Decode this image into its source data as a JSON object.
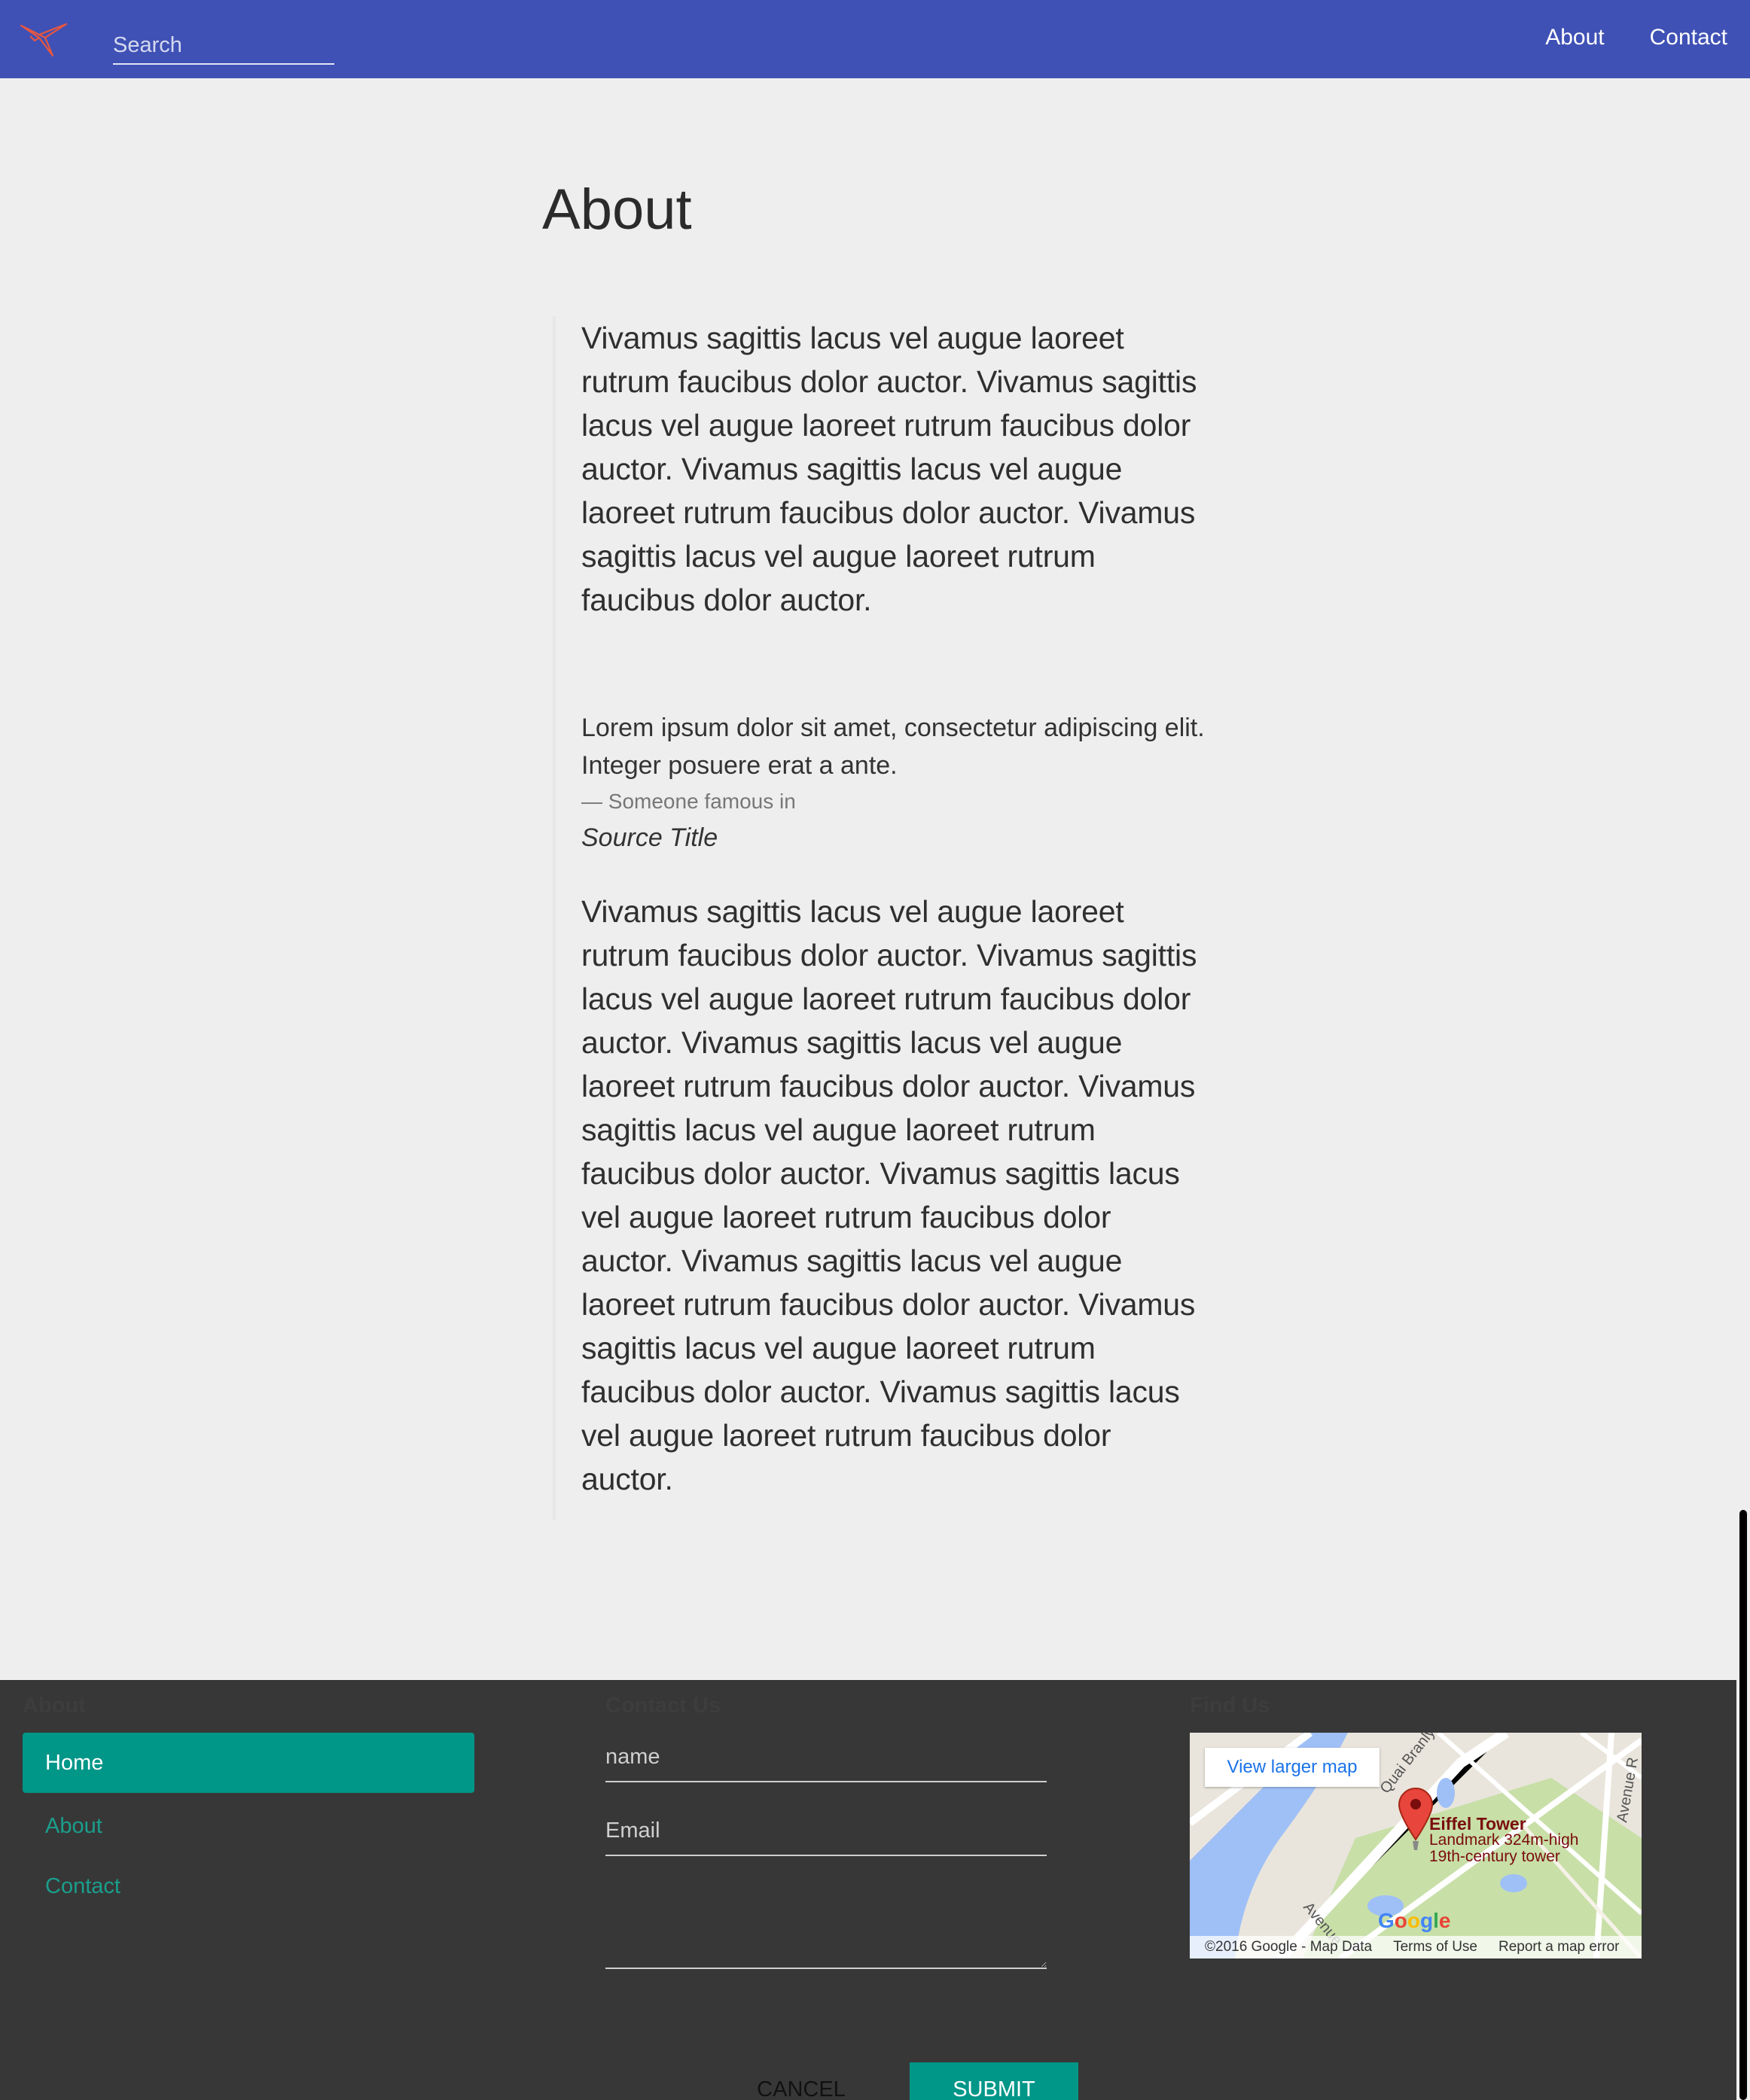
{
  "header": {
    "search_placeholder": "Search",
    "nav": [
      "About",
      "Contact"
    ]
  },
  "main": {
    "title": "About",
    "paragraph_1": "Vivamus sagittis lacus vel augue laoreet rutrum faucibus dolor auctor. Vivamus sagittis lacus vel augue laoreet rutrum faucibus dolor auctor. Vivamus sagittis lacus vel augue laoreet rutrum faucibus dolor auctor. Vivamus sagittis lacus vel augue laoreet rutrum faucibus dolor auctor.",
    "quote": {
      "text": "Lorem ipsum dolor sit amet, consectetur adipiscing elit. Integer posuere erat a ante.",
      "cite": "— Someone famous in",
      "source": "Source Title"
    },
    "paragraph_2": "Vivamus sagittis lacus vel augue laoreet rutrum faucibus dolor auctor. Vivamus sagittis lacus vel augue laoreet rutrum faucibus dolor auctor. Vivamus sagittis lacus vel augue laoreet rutrum faucibus dolor auctor. Vivamus sagittis lacus vel augue laoreet rutrum faucibus dolor auctor. Vivamus sagittis lacus vel augue laoreet rutrum faucibus dolor auctor. Vivamus sagittis lacus vel augue laoreet rutrum faucibus dolor auctor. Vivamus sagittis lacus vel augue laoreet rutrum faucibus dolor auctor. Vivamus sagittis lacus vel augue laoreet rutrum faucibus dolor auctor."
  },
  "footer": {
    "about_heading": "About",
    "contact_heading": "Contact Us",
    "find_heading": "Find Us",
    "nav": [
      {
        "label": "Home",
        "active": true
      },
      {
        "label": "About",
        "active": false
      },
      {
        "label": "Contact",
        "active": false
      }
    ],
    "form": {
      "name_placeholder": "name",
      "email_placeholder": "Email",
      "cancel_label": "CANCEL",
      "submit_label": "SUBMIT"
    },
    "map": {
      "larger_map_label": "View larger map",
      "place_name": "Eiffel Tower",
      "place_desc_1": "Landmark 324m-high",
      "place_desc_2": "19th-century tower",
      "street_1": "Quai Branly",
      "street_2": "Avenue",
      "street_3": "Avenue R",
      "logo": "Google",
      "copyright": "©2016 Google - Map Data",
      "terms": "Terms of Use",
      "report": "Report a map error"
    }
  },
  "colors": {
    "primary": "#3f51b5",
    "accent": "#009688",
    "footer_bg": "#373737",
    "logo_red": "#e8563f"
  },
  "icons": {
    "logo": "origami-bird-logo",
    "map_pin": "map-pin-icon"
  }
}
